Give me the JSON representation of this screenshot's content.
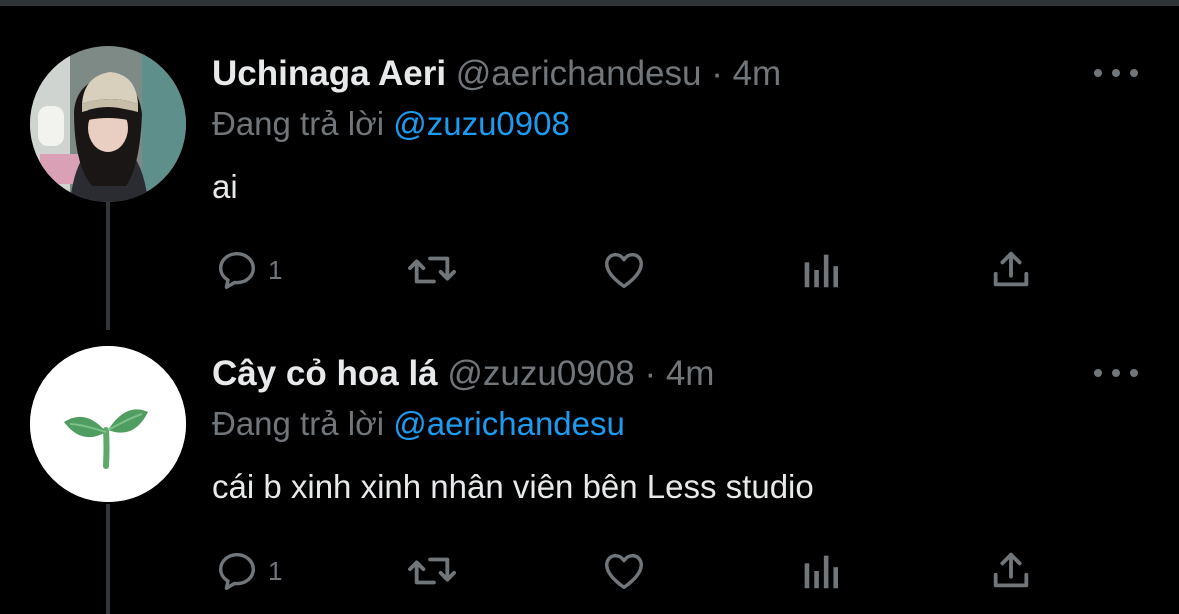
{
  "colors": {
    "background": "#000000",
    "text": "#e7e9ea",
    "muted": "#71767b",
    "accent": "#1d9bf0"
  },
  "tweets": [
    {
      "avatar_icon": "avatar-photo",
      "display_name": "Uchinaga Aeri",
      "handle": "@aerichandesu",
      "separator": "·",
      "time": "4m",
      "reply_prefix": "Đang trả lời",
      "reply_to": "@zuzu0908",
      "text": "ai",
      "actions": {
        "reply_count": "1",
        "icons": [
          "reply-icon",
          "retweet-icon",
          "like-icon",
          "analytics-icon",
          "share-icon"
        ]
      }
    },
    {
      "avatar_icon": "sprout-icon",
      "display_name": "Cây cỏ hoa lá",
      "handle": "@zuzu0908",
      "separator": "·",
      "time": "4m",
      "reply_prefix": "Đang trả lời",
      "reply_to": "@aerichandesu",
      "text": "cái b xinh xinh nhân viên bên Less studio",
      "actions": {
        "reply_count": "1",
        "icons": [
          "reply-icon",
          "retweet-icon",
          "like-icon",
          "analytics-icon",
          "share-icon"
        ]
      }
    }
  ]
}
